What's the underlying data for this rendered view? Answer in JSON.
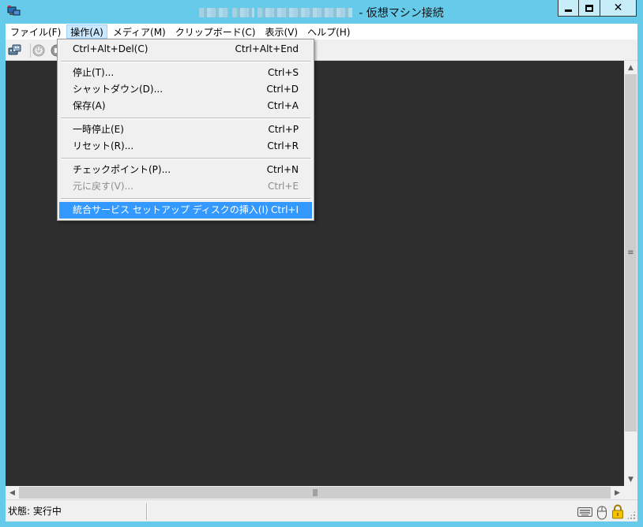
{
  "window": {
    "title": "- 仮想マシン接続",
    "controls": {
      "minimize": "minimize",
      "maximize": "maximize",
      "close": "✕"
    }
  },
  "menubar": {
    "items": [
      {
        "label": "ファイル(F)"
      },
      {
        "label": "操作(A)"
      },
      {
        "label": "メディア(M)"
      },
      {
        "label": "クリップボード(C)"
      },
      {
        "label": "表示(V)"
      },
      {
        "label": "ヘルプ(H)"
      }
    ]
  },
  "toolbar": {
    "icons": [
      "ctrl-alt-del-icon",
      "power-off-icon",
      "shutdown-icon"
    ]
  },
  "dropdown": {
    "items": [
      {
        "label": "Ctrl+Alt+Del(C)",
        "shortcut": "Ctrl+Alt+End"
      },
      {
        "label": "停止(T)...",
        "shortcut": "Ctrl+S"
      },
      {
        "label": "シャットダウン(D)...",
        "shortcut": "Ctrl+D"
      },
      {
        "label": "保存(A)",
        "shortcut": "Ctrl+A"
      },
      {
        "label": "一時停止(E)",
        "shortcut": "Ctrl+P"
      },
      {
        "label": "リセット(R)...",
        "shortcut": "Ctrl+R"
      },
      {
        "label": "チェックポイント(P)...",
        "shortcut": "Ctrl+N"
      },
      {
        "label": "元に戻す(V)...",
        "shortcut": "Ctrl+E"
      },
      {
        "label": "統合サービス セットアップ ディスクの挿入(I)",
        "shortcut": "Ctrl+I"
      }
    ]
  },
  "scrollbars": {
    "v_up": "▲",
    "v_down": "▼",
    "v_grip": "≡",
    "h_left": "◀",
    "h_right": "▶",
    "h_grip": "|||"
  },
  "status": {
    "text": "状態: 実行中",
    "icons": [
      "keyboard-icon",
      "mouse-icon",
      "lock-icon"
    ]
  },
  "colors": {
    "titlebar": "#66cbea",
    "screen": "#2e2e2e",
    "highlight": "#3399ff",
    "active_menu": "#cce8ff"
  }
}
